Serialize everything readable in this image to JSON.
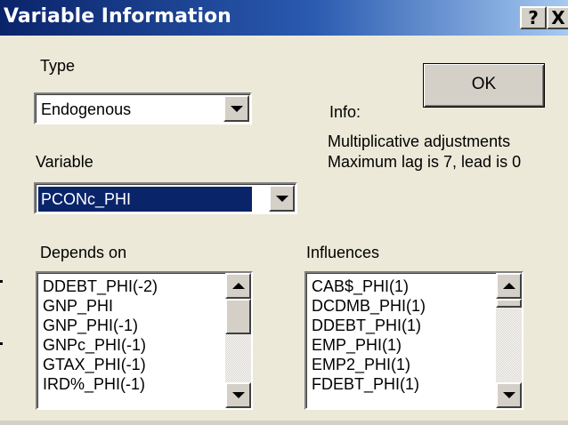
{
  "window": {
    "title": "Variable Information",
    "help_label": "?",
    "close_label": "X"
  },
  "type": {
    "label": "Type",
    "selected": "Endogenous",
    "dropdown_icon": "chevron-down-icon"
  },
  "ok_label": "OK",
  "info": {
    "label": "Info:",
    "line1": "Multiplicative adjustments",
    "line2": "Maximum lag is 7, lead is 0"
  },
  "variable": {
    "label": "Variable",
    "selected": "PCONc_PHI",
    "dropdown_icon": "chevron-down-icon"
  },
  "depends_on": {
    "label": "Depends on",
    "items": [
      "DDEBT_PHI(-2)",
      "GNP_PHI",
      "GNP_PHI(-1)",
      "GNPc_PHI(-1)",
      "GTAX_PHI(-1)",
      "IRD%_PHI(-1)"
    ]
  },
  "influences": {
    "label": "Influences",
    "items": [
      "CAB$_PHI(1)",
      "DCDMB_PHI(1)",
      "DDEBT_PHI(1)",
      "EMP_PHI(1)",
      "EMP2_PHI(1)",
      "FDEBT_PHI(1)"
    ]
  }
}
